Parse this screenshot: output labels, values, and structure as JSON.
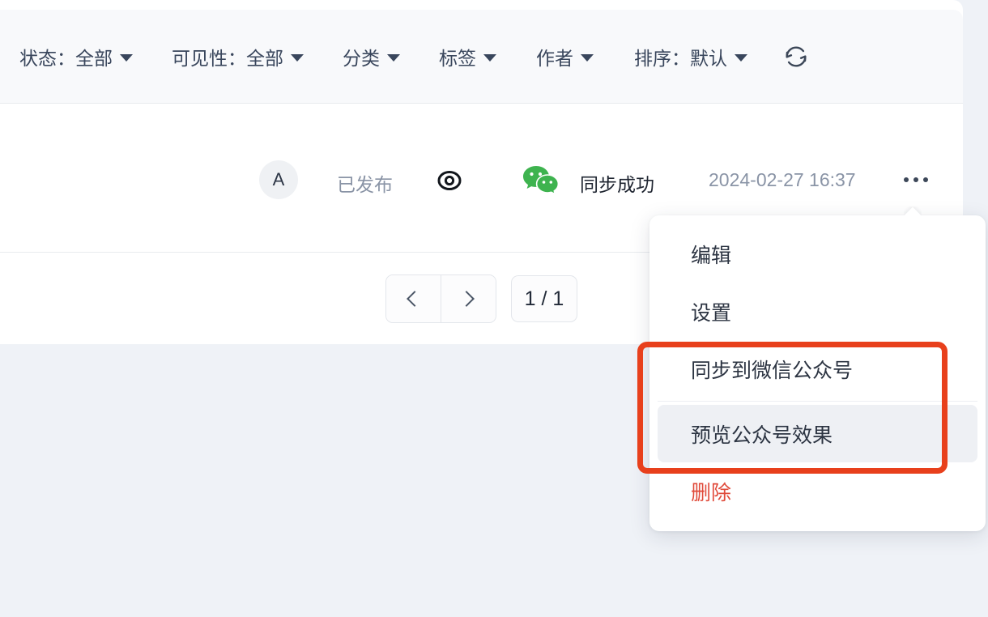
{
  "toolbar": {
    "filters": [
      {
        "label": "状态：全部",
        "name": "filter-status",
        "icon": "chevron-down-icon"
      },
      {
        "label": "可见性：全部",
        "name": "filter-visibility",
        "icon": "chevron-down-icon"
      },
      {
        "label": "分类",
        "name": "filter-category",
        "icon": "chevron-down-icon"
      },
      {
        "label": "标签",
        "name": "filter-tag",
        "icon": "chevron-down-icon"
      },
      {
        "label": "作者",
        "name": "filter-author",
        "icon": "chevron-down-icon"
      },
      {
        "label": "排序：默认",
        "name": "filter-sort",
        "icon": "chevron-down-icon"
      }
    ],
    "refresh_icon": "refresh-icon"
  },
  "article_row": {
    "avatar_initial": "A",
    "status": "已发布",
    "visibility_icon": "eye-icon",
    "platform_icon": "wechat-icon",
    "sync_status": "同步成功",
    "date": "2024-02-27 16:37",
    "more_icon": "more-horizontal-icon"
  },
  "pagination": {
    "prev_icon": "chevron-left-icon",
    "next_icon": "chevron-right-icon",
    "page_indicator": "1 / 1"
  },
  "menu": {
    "items": [
      {
        "label": "编辑",
        "name": "menu-item-edit",
        "state": "normal"
      },
      {
        "label": "设置",
        "name": "menu-item-settings",
        "state": "normal"
      },
      {
        "label": "同步到微信公众号",
        "name": "menu-item-sync-to-wechat",
        "state": "normal"
      },
      {
        "label": "预览公众号效果",
        "name": "menu-item-preview-wechat",
        "state": "hover"
      },
      {
        "label": "删除",
        "name": "menu-item-delete",
        "state": "danger"
      }
    ]
  },
  "colors": {
    "page_background": "#eff2f7",
    "panel_background": "#ffffff",
    "toolbar_background": "#f8f9fb",
    "text_primary": "#2c3442",
    "text_muted": "#8a94a6",
    "danger": "#e04a3a",
    "annotation": "#e8401c",
    "wechat_green": "#3eb34f",
    "hover_background": "#eef0f4"
  }
}
